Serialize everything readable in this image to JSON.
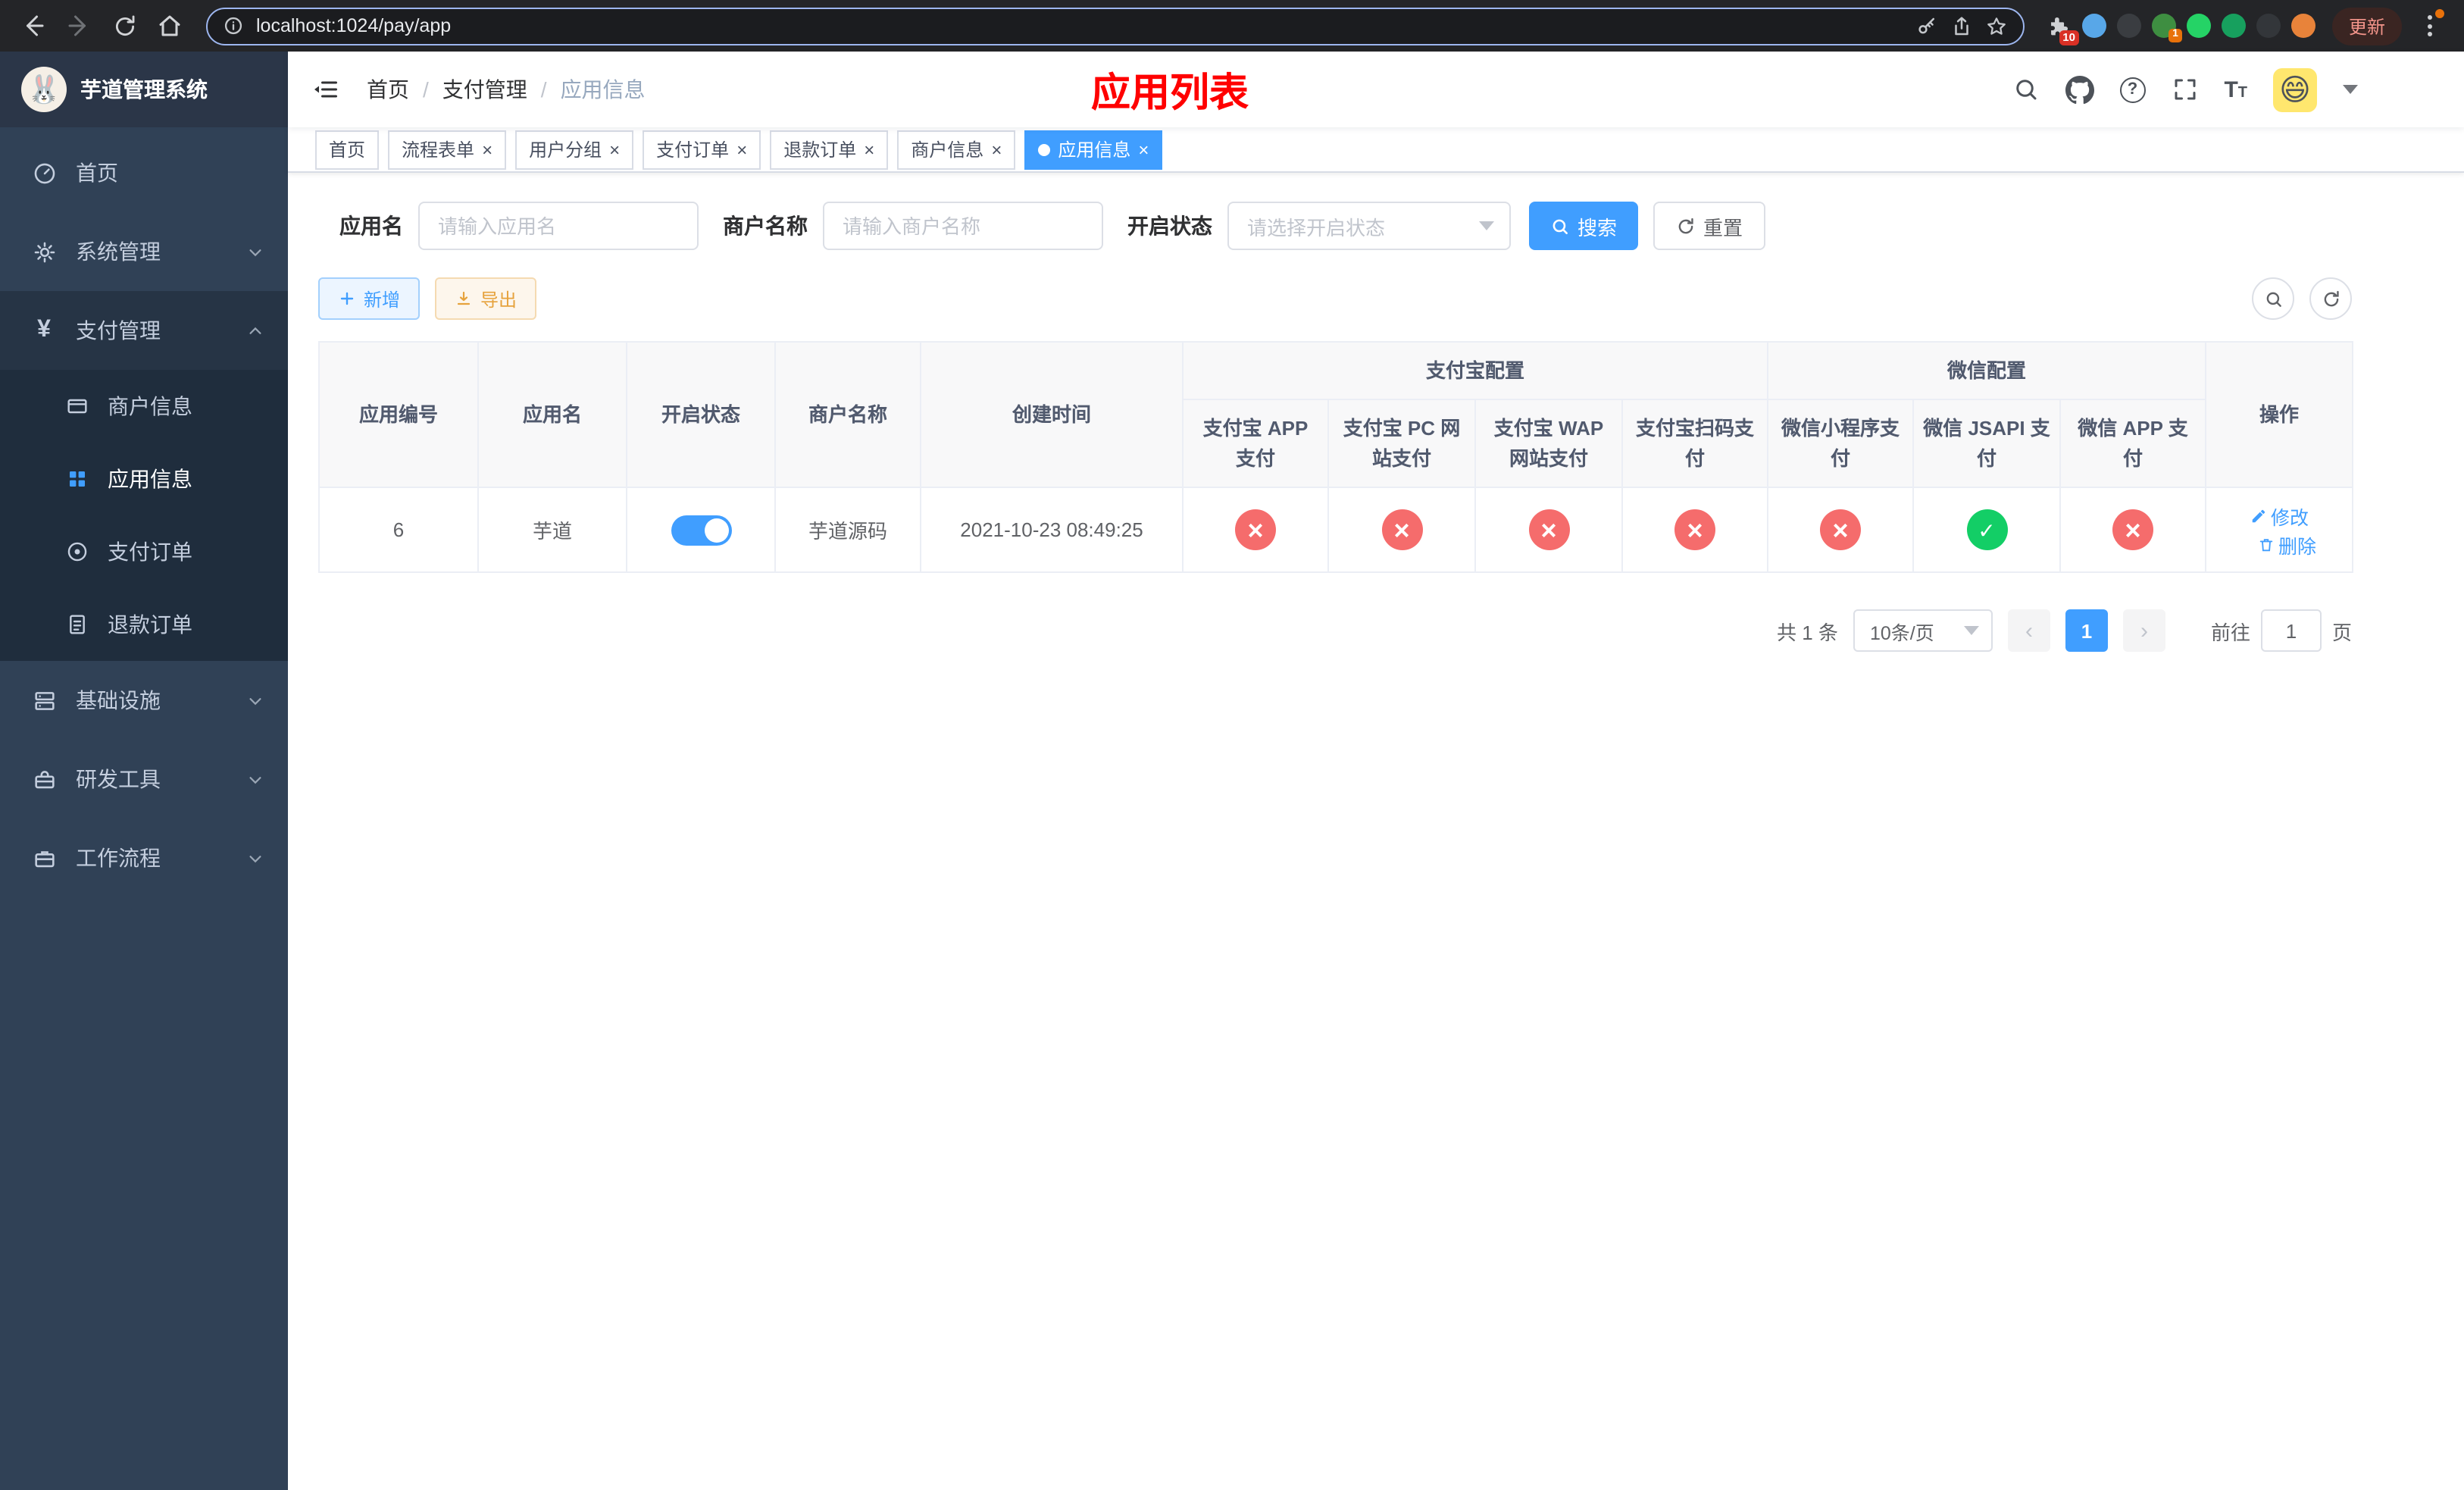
{
  "browser": {
    "url": "localhost:1024/pay/app",
    "update_label": "更新",
    "extensions_badge": "10",
    "extension_badge_2": "1"
  },
  "sidebar": {
    "logo_title": "芋道管理系统",
    "items": [
      {
        "label": "首页"
      },
      {
        "label": "系统管理"
      },
      {
        "label": "支付管理",
        "children": [
          {
            "label": "商户信息"
          },
          {
            "label": "应用信息"
          },
          {
            "label": "支付订单"
          },
          {
            "label": "退款订单"
          }
        ]
      },
      {
        "label": "基础设施"
      },
      {
        "label": "研发工具"
      },
      {
        "label": "工作流程"
      }
    ]
  },
  "header": {
    "breadcrumb": [
      "首页",
      "支付管理",
      "应用信息"
    ],
    "page_title": "应用列表"
  },
  "tabs": [
    {
      "label": "首页",
      "closable": false,
      "active": false
    },
    {
      "label": "流程表单",
      "closable": true,
      "active": false
    },
    {
      "label": "用户分组",
      "closable": true,
      "active": false
    },
    {
      "label": "支付订单",
      "closable": true,
      "active": false
    },
    {
      "label": "退款订单",
      "closable": true,
      "active": false
    },
    {
      "label": "商户信息",
      "closable": true,
      "active": false
    },
    {
      "label": "应用信息",
      "closable": true,
      "active": true
    }
  ],
  "filters": {
    "app_name_label": "应用名",
    "app_name_placeholder": "请输入应用名",
    "merchant_label": "商户名称",
    "merchant_placeholder": "请输入商户名称",
    "status_label": "开启状态",
    "status_placeholder": "请选择开启状态",
    "search_label": "搜索",
    "reset_label": "重置"
  },
  "toolbar": {
    "add_label": "新增",
    "export_label": "导出"
  },
  "table": {
    "groups": {
      "alipay": "支付宝配置",
      "wechat": "微信配置"
    },
    "columns": {
      "id": "应用编号",
      "name": "应用名",
      "status": "开启状态",
      "merchant": "商户名称",
      "created": "创建时间",
      "alipay_app": "支付宝 APP 支付",
      "alipay_pc": "支付宝 PC 网站支付",
      "alipay_wap": "支付宝 WAP 网站支付",
      "alipay_qr": "支付宝扫码支付",
      "wx_mini": "微信小程序支付",
      "wx_jsapi": "微信 JSAPI 支付",
      "wx_app": "微信 APP 支付",
      "actions": "操作"
    },
    "rows": [
      {
        "id": "6",
        "name": "芋道",
        "status_enabled": true,
        "merchant": "芋道源码",
        "created": "2021-10-23 08:49:25",
        "alipay_app": false,
        "alipay_pc": false,
        "alipay_wap": false,
        "alipay_qr": false,
        "wx_mini": false,
        "wx_jsapi": true,
        "wx_app": false,
        "edit_label": "修改",
        "delete_label": "删除"
      }
    ]
  },
  "pagination": {
    "total_text": "共 1 条",
    "page_size_text": "10条/页",
    "current_page": "1",
    "goto_label": "前往",
    "goto_value": "1",
    "page_unit": "页"
  },
  "colors": {
    "accent": "#409eff",
    "success": "#13ce66",
    "danger": "#f56c6c",
    "title": "#ff0000"
  }
}
